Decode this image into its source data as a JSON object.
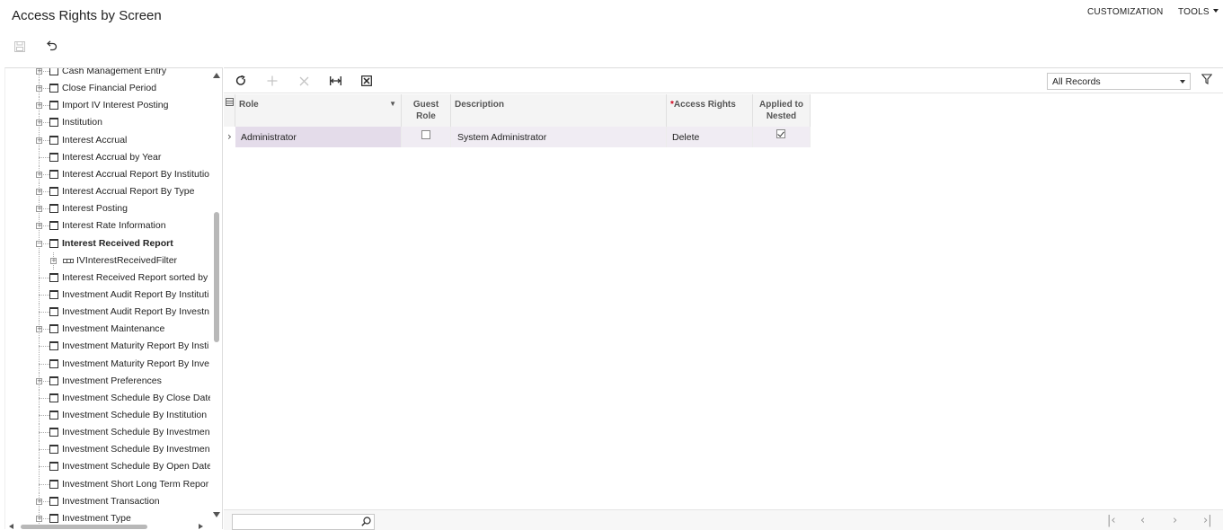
{
  "header": {
    "title": "Access Rights by Screen",
    "customization_label": "CUSTOMIZATION",
    "tools_label": "TOOLS"
  },
  "toolbar": {
    "save_icon": "save-icon",
    "undo_icon": "undo-icon"
  },
  "tree": {
    "items": [
      {
        "label": "Cash Management Entry",
        "expandable": true
      },
      {
        "label": "Close Financial Period",
        "expandable": true
      },
      {
        "label": "Import IV Interest Posting",
        "expandable": true
      },
      {
        "label": "Institution",
        "expandable": true
      },
      {
        "label": "Interest Accrual",
        "expandable": true
      },
      {
        "label": "Interest Accrual by Year",
        "expandable": false
      },
      {
        "label": "Interest Accrual Report By Institutio",
        "expandable": true
      },
      {
        "label": "Interest Accrual Report By Type",
        "expandable": true
      },
      {
        "label": "Interest Posting",
        "expandable": true
      },
      {
        "label": "Interest Rate Information",
        "expandable": true
      },
      {
        "label": "Interest Received Report",
        "expandable": true,
        "expanded": true,
        "bold": true
      },
      {
        "label": "IVInterestReceivedFilter",
        "child": true
      },
      {
        "label": "Interest Received Report sorted by",
        "expandable": false
      },
      {
        "label": "Investment Audit Report By Instituti",
        "expandable": false
      },
      {
        "label": "Investment Audit Report By Investn",
        "expandable": false
      },
      {
        "label": "Investment Maintenance",
        "expandable": true
      },
      {
        "label": "Investment Maturity Report By Insti",
        "expandable": false
      },
      {
        "label": "Investment Maturity Report By Inve",
        "expandable": false
      },
      {
        "label": "Investment Preferences",
        "expandable": true
      },
      {
        "label": "Investment Schedule By Close Date",
        "expandable": false
      },
      {
        "label": "Investment Schedule By Institution",
        "expandable": false
      },
      {
        "label": "Investment Schedule By Investmen",
        "expandable": false
      },
      {
        "label": "Investment Schedule By Investmen",
        "expandable": false
      },
      {
        "label": "Investment Schedule By Open Date",
        "expandable": false
      },
      {
        "label": "Investment Short Long Term Repor",
        "expandable": false
      },
      {
        "label": "Investment Transaction",
        "expandable": true
      },
      {
        "label": "Investment Type",
        "expandable": true
      }
    ]
  },
  "grid": {
    "filter_selected": "All Records",
    "columns": {
      "role": "Role",
      "guest_role": "Guest Role",
      "description": "Description",
      "access_rights": "Access Rights",
      "applied_to_nested": "Applied to Nested"
    },
    "rows": [
      {
        "role": "Administrator",
        "guest_role": false,
        "description": "System Administrator",
        "access_rights": "Delete",
        "applied_to_nested": true
      }
    ]
  },
  "colors": {
    "active_cell": "#e4dcea",
    "required_mark": "#d0021b"
  }
}
